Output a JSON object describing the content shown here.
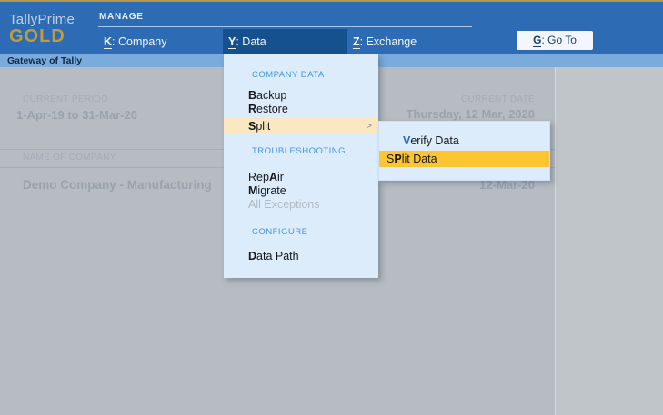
{
  "brand": {
    "product": "TallyPrime",
    "edition": "GOLD"
  },
  "topbar": {
    "section_label": "MANAGE",
    "menu": [
      {
        "hot": "K",
        "rest": ": Company",
        "selected": false
      },
      {
        "hot": "Y",
        "rest": ": Data",
        "selected": true
      },
      {
        "hot": "Z",
        "rest": ": Exchange",
        "selected": false
      }
    ],
    "goto_button": {
      "hot": "G",
      "rest": ": Go To"
    }
  },
  "breadcrumb": "Gateway of Tally",
  "dropdown": {
    "header_company_data": "COMPANY DATA",
    "backup": {
      "pre": "",
      "hot": "B",
      "post": "ackup"
    },
    "restore": {
      "pre": "",
      "hot": "R",
      "post": "estore"
    },
    "split": {
      "pre": "",
      "hot": "S",
      "post": "plit"
    },
    "split_arrow": ">",
    "header_troubleshooting": "TROUBLESHOOTING",
    "repair": {
      "pre": "Rep",
      "hot": "A",
      "post": "ir"
    },
    "migrate": {
      "pre": "",
      "hot": "M",
      "post": "igrate"
    },
    "all_exceptions": "All Exceptions",
    "header_configure": "CONFIGURE",
    "data_path": {
      "pre": "",
      "hot": "D",
      "post": "ata Path"
    }
  },
  "submenu": {
    "verify_data": {
      "pre": "",
      "hot": "V",
      "post": "erify Data"
    },
    "split_data": {
      "pre": "S",
      "hot": "P",
      "post": "lit Data"
    }
  },
  "info": {
    "current_period_label": "CURRENT PERIOD",
    "current_period": "1-Apr-19 to 31-Mar-20",
    "current_date_label": "CURRENT DATE",
    "current_date": "Thursday, 12 Mar, 2020",
    "name_of_company_label": "NAME OF COMPANY",
    "company_name": "Demo Company - Manufacturing",
    "company_date": "12-Mar-20"
  },
  "colors": {
    "top_gold_strip": "#b2974d",
    "top_bar_blue": "#2d6cb4",
    "selected_menu_blue": "#15518d",
    "brand_gold": "#c09c3e",
    "gateway_bar_blue": "#7aabdc",
    "menu_panel_bg": "#dcecfa",
    "section_header_blue": "#4596d9",
    "hover_highlight_soft": "#fbe7c0",
    "selected_highlight_amber": "#fdc52f",
    "dimmed_content_bg": "#b6bcc1",
    "goto_button_bg": "#f3f7fb"
  }
}
